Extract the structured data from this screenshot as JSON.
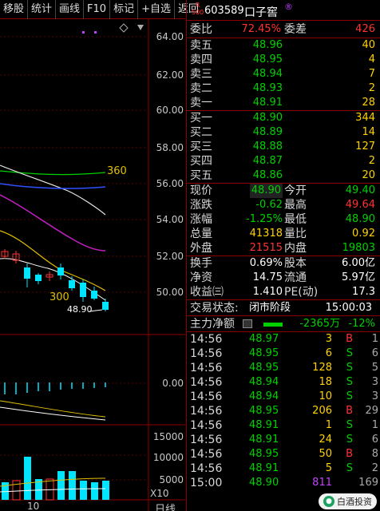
{
  "toolbar": {
    "items": [
      "移股",
      "统计",
      "画线",
      "F10",
      "标记",
      "+自选",
      "返回"
    ]
  },
  "chart": {
    "price_axis": [
      "64.00",
      "62.00",
      "60.00",
      "58.00",
      "56.00",
      "54.00",
      "52.00",
      "50.00"
    ],
    "ma_label_360": "360",
    "ma_label_300": "300",
    "price_annotation": "48.90",
    "indicator_axis": [
      "0.00"
    ],
    "volume_axis": [
      "15000",
      "10000",
      "5000"
    ],
    "volume_unit": "X10",
    "date_label": "10",
    "period_label": "日线"
  },
  "header": {
    "badge_top": "R",
    "badge_bottom": "500",
    "code": "603589",
    "name": "口子窖",
    "mark": "®"
  },
  "order_book": {
    "weibi_label": "委比",
    "weibi_value": "72.45%",
    "weicha_label": "委差",
    "weicha_value": "426",
    "sells": [
      {
        "label": "卖五",
        "price": "48.96",
        "vol": "40"
      },
      {
        "label": "卖四",
        "price": "48.95",
        "vol": "4"
      },
      {
        "label": "卖三",
        "price": "48.94",
        "vol": "7"
      },
      {
        "label": "卖二",
        "price": "48.93",
        "vol": "2"
      },
      {
        "label": "卖一",
        "price": "48.91",
        "vol": "28"
      }
    ],
    "buys": [
      {
        "label": "买一",
        "price": "48.90",
        "vol": "344"
      },
      {
        "label": "买二",
        "price": "48.89",
        "vol": "14"
      },
      {
        "label": "买三",
        "price": "48.88",
        "vol": "127"
      },
      {
        "label": "买四",
        "price": "48.87",
        "vol": "2"
      },
      {
        "label": "买五",
        "price": "48.86",
        "vol": "20"
      }
    ]
  },
  "quote": {
    "rows": [
      {
        "l1": "现价",
        "v1": "48.90",
        "l2": "今开",
        "v2": "49.40"
      },
      {
        "l1": "涨跌",
        "v1": "-0.62",
        "l2": "最高",
        "v2": "49.64"
      },
      {
        "l1": "涨幅",
        "v1": "-1.25%",
        "l2": "最低",
        "v2": "48.90"
      },
      {
        "l1": "总量",
        "v1": "41318",
        "l2": "量比",
        "v2": "0.92"
      },
      {
        "l1": "外盘",
        "v1": "21515",
        "l2": "内盘",
        "v2": "19803"
      }
    ],
    "rows2": [
      {
        "l1": "换手",
        "v1": "0.69%",
        "l2": "股本",
        "v2": "6.00亿"
      },
      {
        "l1": "净资",
        "v1": "14.75",
        "l2": "流通",
        "v2": "5.97亿"
      },
      {
        "l1": "收益㈢",
        "v1": "1.410",
        "l2": "PE(动)",
        "v2": "17.3"
      }
    ],
    "status_label": "交易状态:",
    "status_value": "闭市阶段",
    "status_time": "15:00:03",
    "main_flow_label": "主力净额",
    "main_flow_value": "-2365万",
    "main_flow_pct": "-12%"
  },
  "ticks": [
    {
      "time": "14:56",
      "price": "48.97",
      "vol": "3",
      "side": "B",
      "n": "1"
    },
    {
      "time": "14:56",
      "price": "48.95",
      "vol": "6",
      "side": "S",
      "n": "6"
    },
    {
      "time": "14:56",
      "price": "48.95",
      "vol": "128",
      "side": "S",
      "n": "5"
    },
    {
      "time": "14:56",
      "price": "48.94",
      "vol": "18",
      "side": "S",
      "n": "3"
    },
    {
      "time": "14:56",
      "price": "48.94",
      "vol": "10",
      "side": "S",
      "n": "3"
    },
    {
      "time": "14:56",
      "price": "48.95",
      "vol": "206",
      "side": "B",
      "n": "29"
    },
    {
      "time": "14:56",
      "price": "48.91",
      "vol": "1",
      "side": "S",
      "n": "1"
    },
    {
      "time": "14:56",
      "price": "48.91",
      "vol": "24",
      "side": "S",
      "n": "6"
    },
    {
      "time": "14:56",
      "price": "48.95",
      "vol": "50",
      "side": "B",
      "n": "8"
    },
    {
      "time": "14:56",
      "price": "48.91",
      "vol": "5",
      "side": "S",
      "n": "2"
    },
    {
      "time": "15:00",
      "price": "48.90",
      "vol": "811",
      "side": "",
      "n": "169"
    }
  ],
  "watermark": {
    "text": "白酒投资"
  },
  "colors": {
    "up": "#ff3333",
    "down": "#00d000",
    "accent_border": "#8b0000",
    "candle_down": "#00e5ff"
  }
}
